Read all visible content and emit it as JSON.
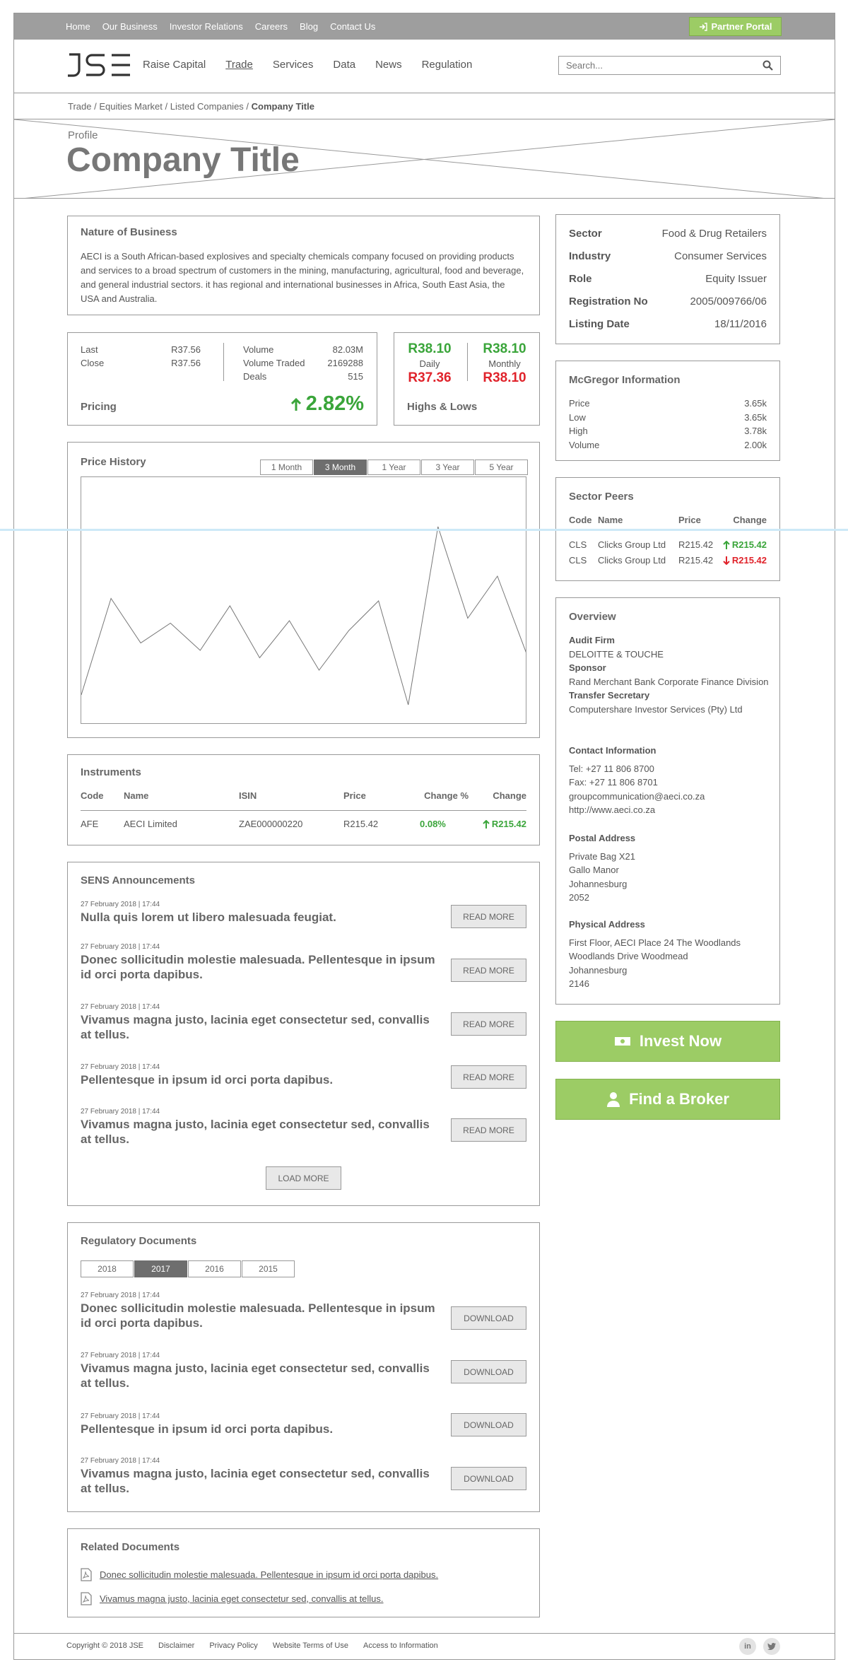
{
  "topnav": {
    "items": [
      "Home",
      "Our Business",
      "Investor Relations",
      "Careers",
      "Blog",
      "Contact Us"
    ],
    "portal_label": "Partner Portal"
  },
  "mainnav": {
    "items": [
      "Raise Capital",
      "Trade",
      "Services",
      "Data",
      "News",
      "Regulation"
    ],
    "active": "Trade",
    "search_placeholder": "Search..."
  },
  "breadcrumb": {
    "path": "Trade / Equities Market / Listed Companies / ",
    "current": "Company Title"
  },
  "hero": {
    "kicker": "Profile",
    "title": "Company Title"
  },
  "nature": {
    "heading": "Nature of Business",
    "text": "AECI is a South African-based explosives and specialty chemicals company focused on providing products and services to a broad spectrum of customers in the mining, manufacturing, agricultural, food and beverage, and general industrial sectors. it has regional and international businesses in Africa, South East Asia, the USA and Australia."
  },
  "pricing": {
    "last_label": "Last",
    "last": "R37.56",
    "close_label": "Close",
    "close": "R37.56",
    "volume_label": "Volume",
    "volume": "82.03M",
    "traded_label": "Volume Traded",
    "traded": "2169288",
    "deals_label": "Deals",
    "deals": "515",
    "heading": "Pricing",
    "change": "2.82%"
  },
  "highs_lows": {
    "daily_high": "R38.10",
    "daily_label": "Daily",
    "daily_low": "R37.36",
    "monthly_high": "R38.10",
    "monthly_label": "Monthly",
    "monthly_low": "R38.10",
    "heading": "Highs & Lows"
  },
  "price_history": {
    "heading": "Price History",
    "periods": [
      "1 Month",
      "3 Month",
      "1 Year",
      "3 Year",
      "5 Year"
    ],
    "active_period": "3 Month"
  },
  "chart_data": {
    "type": "line",
    "title": "",
    "xlabel": "",
    "ylabel": "",
    "grid": false,
    "points": [
      [
        0,
        12
      ],
      [
        1,
        51
      ],
      [
        2,
        33
      ],
      [
        3,
        41
      ],
      [
        4,
        30
      ],
      [
        5,
        48
      ],
      [
        6,
        27
      ],
      [
        7,
        42
      ],
      [
        8,
        22
      ],
      [
        9,
        38
      ],
      [
        10,
        50
      ],
      [
        11,
        8
      ],
      [
        12,
        80
      ],
      [
        13,
        43
      ],
      [
        14,
        60
      ],
      [
        15,
        28
      ]
    ]
  },
  "instruments": {
    "heading": "Instruments",
    "columns": [
      "Code",
      "Name",
      "ISIN",
      "Price",
      "Change %",
      "Change"
    ],
    "rows": [
      {
        "code": "AFE",
        "name": "AECI Limited",
        "isin": "ZAE000000220",
        "price": "R215.42",
        "change_pct": "0.08%",
        "change": "R215.42"
      }
    ]
  },
  "sens": {
    "heading": "SENS Announcements",
    "read_more": "READ MORE",
    "load_more": "LOAD MORE",
    "items": [
      {
        "date": "27 February 2018 | 17:44",
        "title": "Nulla quis lorem ut libero malesuada feugiat."
      },
      {
        "date": "27 February 2018 | 17:44",
        "title": "Donec sollicitudin molestie malesuada. Pellentesque in ipsum id orci porta dapibus."
      },
      {
        "date": "27 February 2018 | 17:44",
        "title": "Vivamus magna justo, lacinia eget consectetur sed, convallis at tellus."
      },
      {
        "date": "27 February 2018 | 17:44",
        "title": "Pellentesque in ipsum id orci porta dapibus."
      },
      {
        "date": "27 February 2018 | 17:44",
        "title": "Vivamus magna justo, lacinia eget consectetur sed, convallis at tellus."
      }
    ]
  },
  "regulatory": {
    "heading": "Regulatory Documents",
    "years": [
      "2018",
      "2017",
      "2016",
      "2015"
    ],
    "active_year": "2017",
    "download": "DOWNLOAD",
    "items": [
      {
        "date": "27 February 2018 | 17:44",
        "title": "Donec sollicitudin molestie malesuada. Pellentesque in ipsum id orci porta dapibus."
      },
      {
        "date": "27 February 2018 | 17:44",
        "title": "Vivamus magna justo, lacinia eget consectetur sed, convallis at tellus."
      },
      {
        "date": "27 February 2018 | 17:44",
        "title": "Pellentesque in ipsum id orci porta dapibus."
      },
      {
        "date": "27 February 2018 | 17:44",
        "title": "Vivamus magna justo, lacinia eget consectetur sed, convallis at tellus."
      }
    ]
  },
  "related": {
    "heading": "Related Documents",
    "items": [
      "Donec sollicitudin molestie malesuada. Pellentesque in ipsum id orci porta dapibus.",
      "Vivamus magna justo, lacinia eget consectetur sed, convallis at tellus."
    ]
  },
  "profile": {
    "rows": [
      {
        "label": "Sector",
        "value": "Food & Drug Retailers"
      },
      {
        "label": "Industry",
        "value": "Consumer Services"
      },
      {
        "label": "Role",
        "value": "Equity Issuer"
      },
      {
        "label": "Registration No",
        "value": "2005/009766/06"
      },
      {
        "label": "Listing Date",
        "value": "18/11/2016"
      }
    ]
  },
  "mcgregor": {
    "heading": "McGregor Information",
    "rows": [
      {
        "label": "Price",
        "value": "3.65k"
      },
      {
        "label": "Low",
        "value": "3.65k"
      },
      {
        "label": "High",
        "value": "3.78k"
      },
      {
        "label": "Volume",
        "value": "2.00k"
      }
    ]
  },
  "peers": {
    "heading": "Sector Peers",
    "columns": [
      "Code",
      "Name",
      "Price",
      "Change"
    ],
    "rows": [
      {
        "code": "CLS",
        "name": "Clicks Group Ltd",
        "price": "R215.42",
        "change": "R215.42",
        "direction": "up"
      },
      {
        "code": "CLS",
        "name": "Clicks Group Ltd",
        "price": "R215.42",
        "change": "R215.42",
        "direction": "down"
      }
    ]
  },
  "overview": {
    "heading": "Overview",
    "audit_label": "Audit Firm",
    "audit": "DELOITTE & TOUCHE",
    "sponsor_label": "Sponsor",
    "sponsor": "Rand Merchant Bank Corporate Finance Division",
    "transfer_label": "Transfer Secretary",
    "transfer": "Computershare Investor Services (Pty) Ltd",
    "contact_heading": "Contact Information",
    "contact": [
      "Tel: +27 11 806 8700",
      "Fax: +27 11 806 8701",
      "groupcommunication@aeci.co.za",
      "http://www.aeci.co.za"
    ],
    "postal_heading": "Postal Address",
    "postal": [
      "Private Bag X21",
      "Gallo Manor",
      "Johannesburg",
      "2052"
    ],
    "physical_heading": "Physical Address",
    "physical": [
      "First Floor, AECI Place 24 The Woodlands Woodlands Drive Woodmead",
      "Johannesburg",
      "2146"
    ]
  },
  "cta": {
    "invest": "Invest Now",
    "broker": "Find a Broker"
  },
  "footer": {
    "links": [
      "Copyright © 2018 JSE",
      "Disclaimer",
      "Privacy Policy",
      "Website Terms of Use",
      "Access to Information"
    ],
    "social": [
      "in",
      "t"
    ]
  },
  "colors": {
    "accent_green": "#9ccc65",
    "up": "#3aa53a",
    "down": "#e0232b",
    "topbar": "#9e9e9e"
  }
}
